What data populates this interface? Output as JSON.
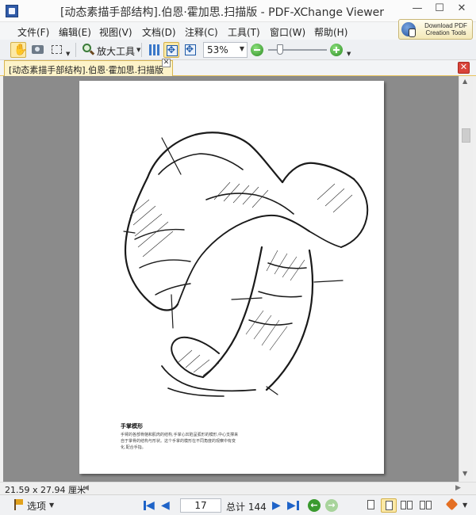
{
  "window": {
    "title": "[动态素描手部结构].伯恩·霍加思.扫描版 - PDF-XChange Viewer",
    "controls": {
      "minimize": "—",
      "maximize": "☐",
      "close": "✕"
    }
  },
  "menu": {
    "items": [
      "文件(F)",
      "编辑(E)",
      "视图(V)",
      "文档(D)",
      "注释(C)",
      "工具(T)",
      "窗口(W)",
      "帮助(H)"
    ]
  },
  "download_button": {
    "line1": "Download PDF",
    "line2": "Creation Tools"
  },
  "toolbar": {
    "zoom_tool_label": "放大工具",
    "zoom_value": "53%",
    "zoom_level_fraction": 0.2
  },
  "tab": {
    "label": "[动态素描手部结构].伯恩·霍加思.扫描版"
  },
  "document": {
    "caption_title": "手掌模形",
    "caption_body": "手臂的各部骨骼和肌肉的结构,手掌心凹陷呈弧形的模形,中心支撑来自于掌骨的结构与形状。这个手掌的模形在不同角度的观察中有变化,配合手指。"
  },
  "statusbar": {
    "page_size": "21.59 x 27.94 厘米",
    "options_label": "选项",
    "current_page": "17",
    "total_label": "总计 144"
  },
  "icons": {
    "hand": "hand-tool-icon",
    "snapshot": "snapshot-icon",
    "select": "select-text-icon",
    "zoom": "magnifier-icon",
    "zoom_out": "zoom-out-icon",
    "zoom_in": "zoom-in-icon",
    "first": "first-page-icon",
    "prev": "previous-page-icon",
    "next": "next-page-icon",
    "last": "last-page-icon",
    "back": "back-icon",
    "forward": "forward-icon"
  },
  "colors": {
    "accent": "#fce9a6",
    "nav_blue": "#1e63c8",
    "nav_green": "#3a9a2e",
    "viewport": "#8b8b8b"
  }
}
